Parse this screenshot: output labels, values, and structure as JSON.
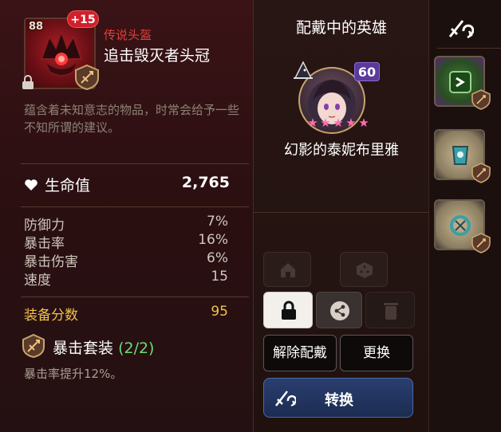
{
  "item": {
    "level": "88",
    "enhance": "+15",
    "rarity": "传说头盔",
    "name": "追击毁灭者头冠",
    "description": "蕴含着未知意志的物品，时常会给予一些不知所谓的建议。"
  },
  "main_stat": {
    "label": "生命值",
    "value": "2,765",
    "icon": "heart-icon"
  },
  "sub_stats": [
    {
      "label": "防御力",
      "value": "7%"
    },
    {
      "label": "暴击率",
      "value": "16%"
    },
    {
      "label": "暴击伤害",
      "value": "6%"
    },
    {
      "label": "速度",
      "value": "15"
    }
  ],
  "gear_score": {
    "label": "装备分数",
    "value": "95"
  },
  "set": {
    "name": "暴击套装",
    "count": "(2/2)",
    "effect": "暴击率提升12%。"
  },
  "hero_panel": {
    "title": "配戴中的英雄",
    "hero_level": "60",
    "stars": 6,
    "hero_name": "幻影的泰妮布里雅"
  },
  "buttons": {
    "unequip": "解除配戴",
    "change": "更换",
    "switch": "转换"
  },
  "colors": {
    "rarity": "#e0403a",
    "gear_score": "#f0c24a",
    "set_count": "#6fdc6f",
    "switch_button": "#2a3e6e"
  }
}
